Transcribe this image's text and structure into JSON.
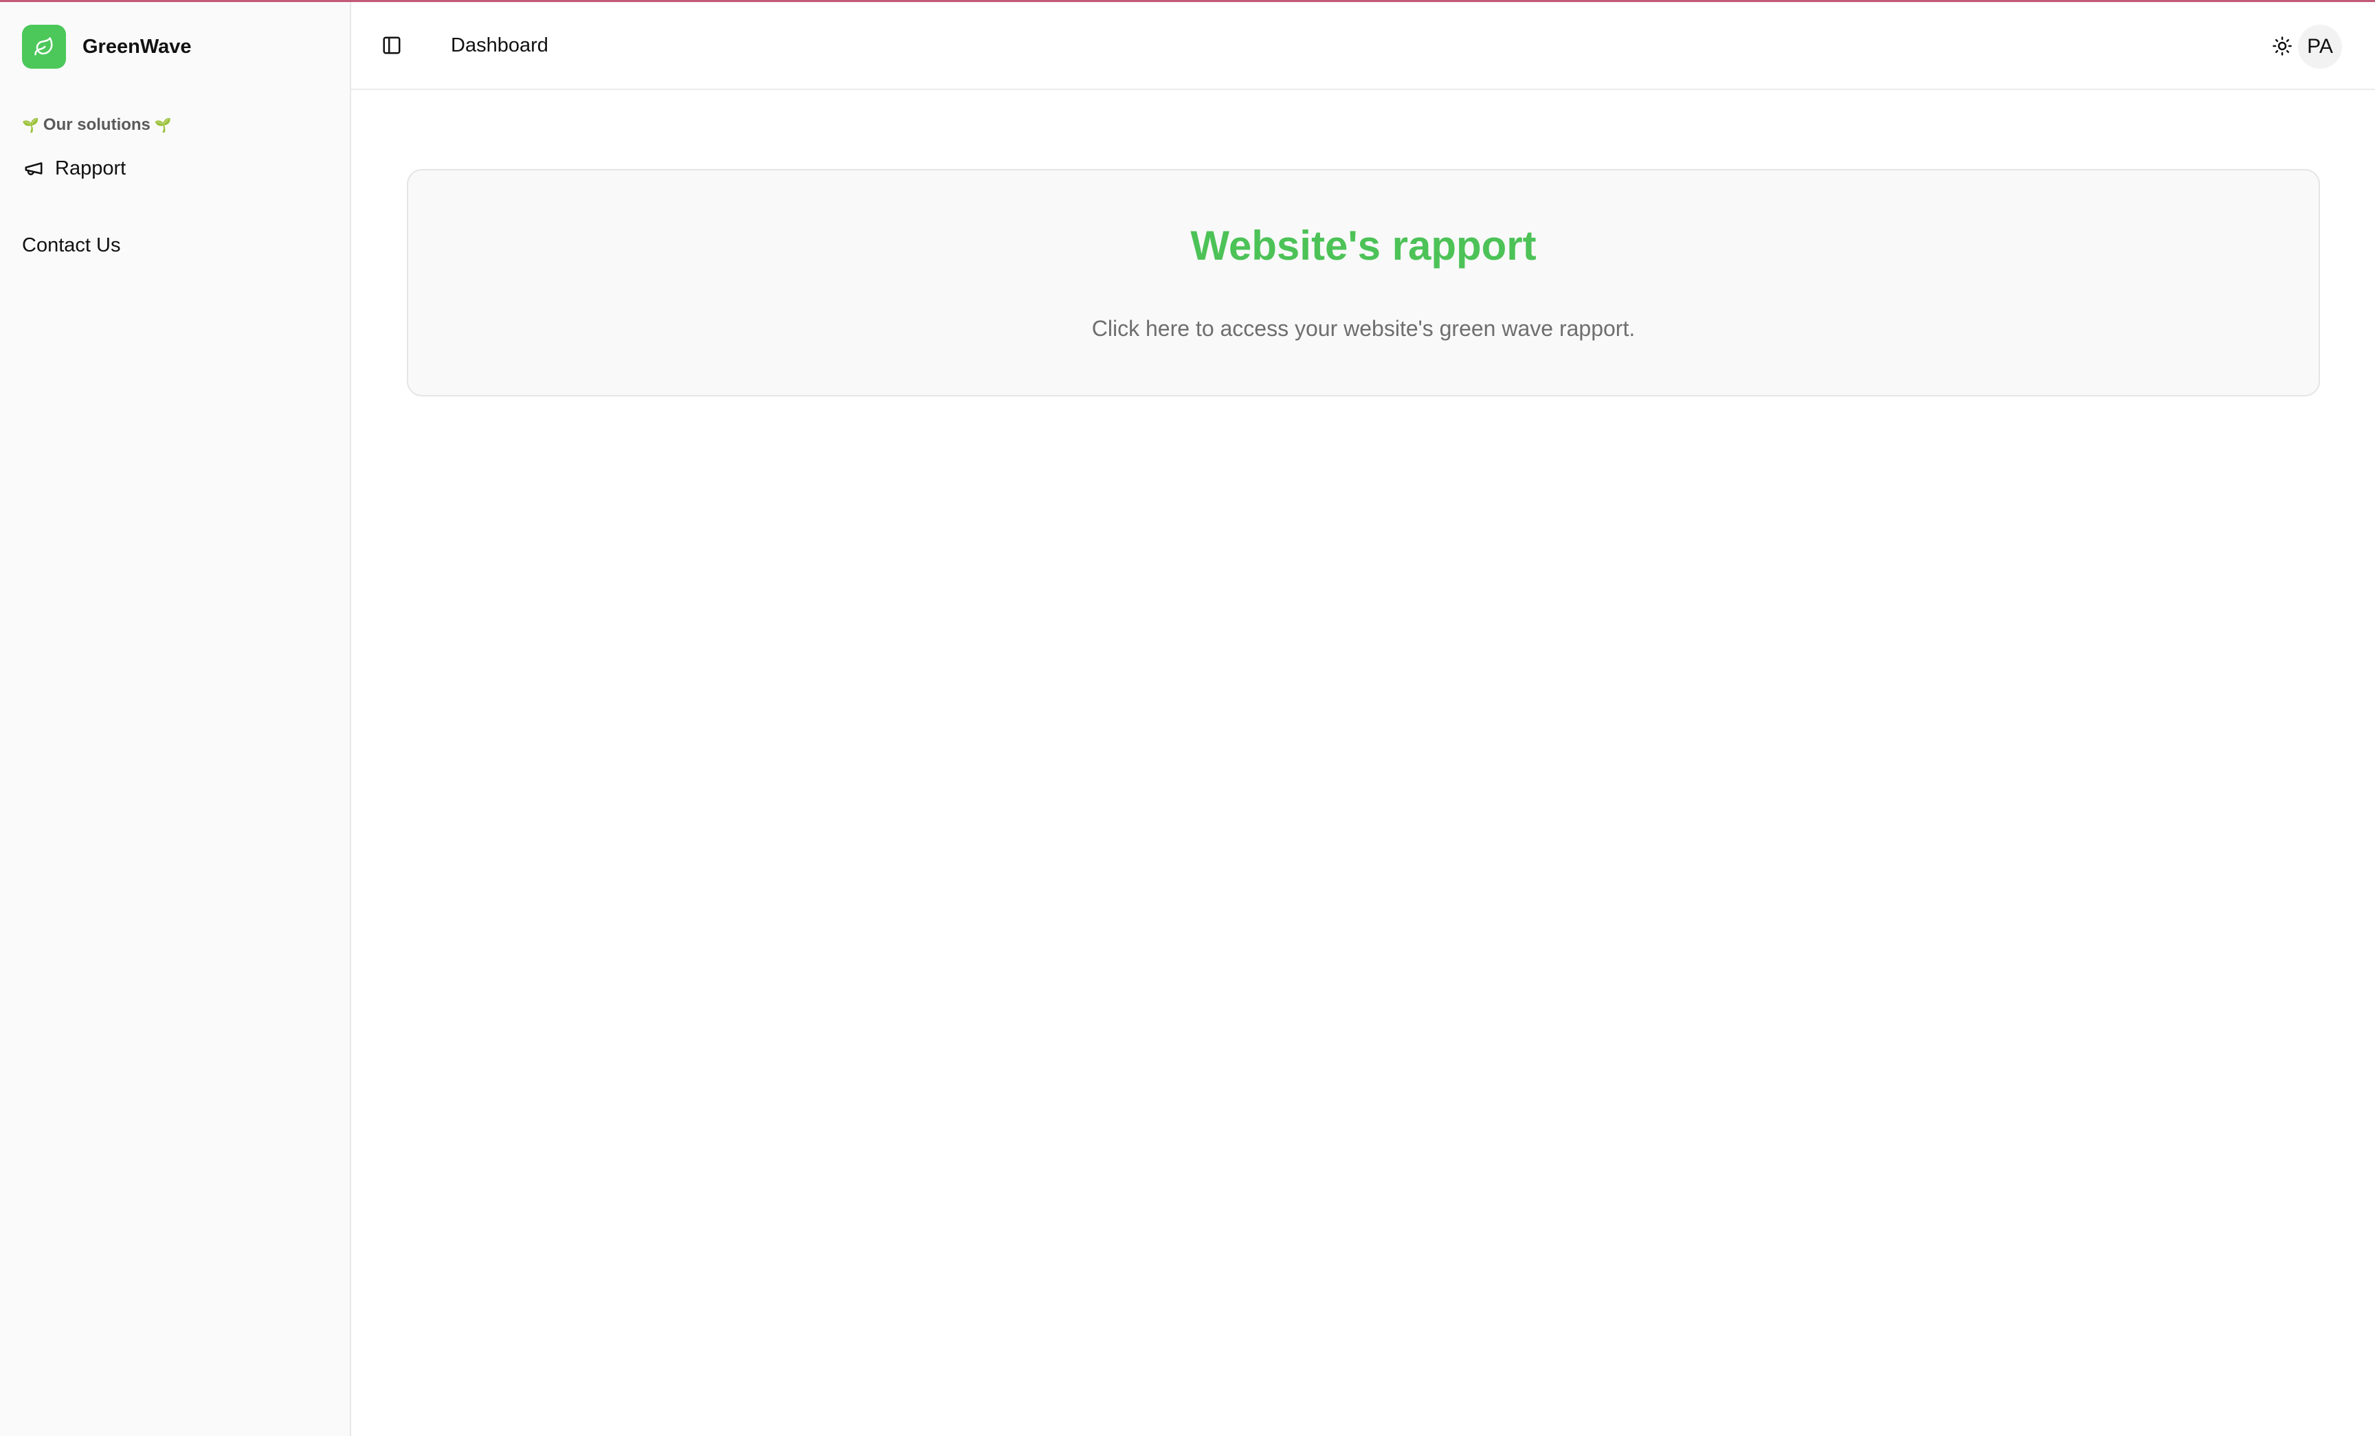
{
  "sidebar": {
    "brand": {
      "name": "GreenWave",
      "logo_icon": "leaf-icon"
    },
    "section_label": "Our solutions",
    "section_emoji": "🌱",
    "items": [
      {
        "label": "Rapport",
        "icon": "megaphone-icon"
      }
    ],
    "contact_label": "Contact Us"
  },
  "header": {
    "toggle_icon": "panel-left-icon",
    "title": "Dashboard",
    "theme_icon": "sun-icon",
    "avatar_initials": "PA"
  },
  "main": {
    "card": {
      "title": "Website's rapport",
      "description": "Click here to access your website's green wave rapport."
    }
  },
  "colors": {
    "accent": "#4cc257",
    "logo_bg": "#4cc85a",
    "top_border": "#c25a78"
  }
}
